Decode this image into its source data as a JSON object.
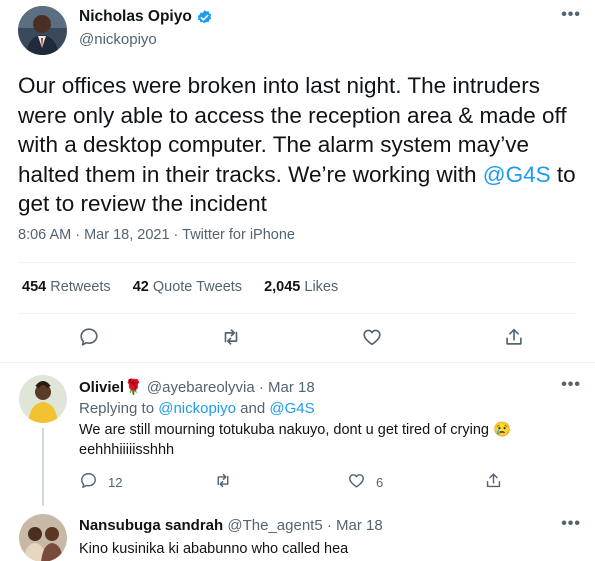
{
  "tweet": {
    "author_name": "Nicholas Opiyo",
    "author_handle": "@nickopiyo",
    "text_before": "Our offices were broken into last night. The intruders were only able to access the reception area & made off with a desktop computer. The alarm system may’ve halted them in their tracks. We’re working with ",
    "mention": "@G4S",
    "text_after": " to get to review the incident",
    "meta": "8:06 AM · Mar 18, 2021 · Twitter for iPhone",
    "retweets_count": "454",
    "retweets_label": "Retweets",
    "quotes_count": "42",
    "quotes_label": "Quote Tweets",
    "likes_count": "2,045",
    "likes_label": "Likes"
  },
  "replies": [
    {
      "name": "Oliviel",
      "emoji": "🌹",
      "handle_time": "@ayebareolyvia · Mar 18",
      "replying_prefix": "Replying to ",
      "replying_user1": "@nickopiyo",
      "replying_and": " and ",
      "replying_user2": "@G4S",
      "text": "We are still mourning totukuba nakuyo, dont  u get tired of crying 😢 eehhhiiiiisshhh",
      "reply_count": "12",
      "like_count": "6"
    },
    {
      "name": "Nansubuga sandrah",
      "handle_time": "@The_agent5 · Mar 18",
      "text": "Kino kusinika ki ababunno who called hea"
    }
  ],
  "icons": [
    "verified-badge-icon",
    "more-icon",
    "reply-icon",
    "retweet-icon",
    "like-icon",
    "share-icon"
  ],
  "colors": {
    "accent": "#1d9bf0",
    "secondary_text": "#536471",
    "divider": "#eff3f4"
  }
}
